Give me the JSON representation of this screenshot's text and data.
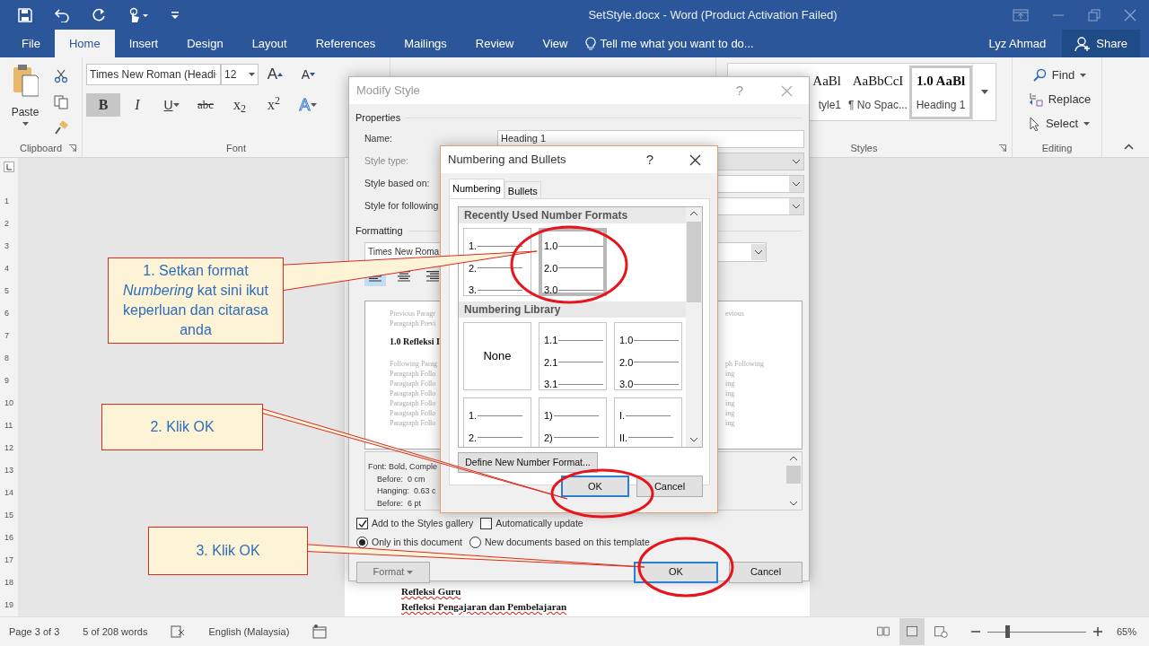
{
  "title_bar": {
    "title": "SetStyle.docx - Word (Product Activation Failed)"
  },
  "ribbon_tabs": [
    {
      "label": "File",
      "selected": false
    },
    {
      "label": "Home",
      "selected": true
    },
    {
      "label": "Insert",
      "selected": false
    },
    {
      "label": "Design",
      "selected": false
    },
    {
      "label": "Layout",
      "selected": false
    },
    {
      "label": "References",
      "selected": false
    },
    {
      "label": "Mailings",
      "selected": false
    },
    {
      "label": "Review",
      "selected": false
    },
    {
      "label": "View",
      "selected": false
    }
  ],
  "tell_me": {
    "placeholder": "Tell me what you want to do..."
  },
  "user": "Lyz Ahmad",
  "share_button": "Share",
  "clipboard": {
    "paste": "Paste",
    "group_label": "Clipboard"
  },
  "font": {
    "font_name": "Times New Roman (Headi",
    "font_size": "12",
    "size_buttons": [
      {
        "label": "A",
        "kind": "grow"
      },
      {
        "label": "A",
        "kind": "shrink"
      }
    ],
    "format_buttons": [
      {
        "label": "B",
        "kind": "bold",
        "on": true
      },
      {
        "label": "I",
        "kind": "italic",
        "on": false
      },
      {
        "label": "U",
        "kind": "underline",
        "on": false
      },
      {
        "label": "abc",
        "kind": "strike",
        "on": false
      },
      {
        "label": "x$_{2}$",
        "kind": "script",
        "on": false
      },
      {
        "label": "x$^{2}$",
        "kind": "script",
        "on": false
      },
      {
        "label": "A",
        "kind": "effect",
        "on": false
      }
    ],
    "group_label": "Font"
  },
  "styles": {
    "gallery": [
      {
        "preview": "AaBl",
        "name": "tyle1",
        "selected": false
      },
      {
        "preview": "AaBbCcI",
        "name": "¶ No Spac...",
        "selected": false
      },
      {
        "preview": "1.0  AaBl",
        "name": "Heading 1",
        "selected": true
      }
    ],
    "group_label": "Styles"
  },
  "editing": {
    "items": [
      {
        "label": "Find",
        "kind": "find"
      },
      {
        "label": "Replace",
        "kind": "replace"
      },
      {
        "label": "Select",
        "kind": "select"
      }
    ],
    "group_label": "Editing"
  },
  "ruler": [
    "1",
    "2",
    "3",
    "4",
    "5",
    "6",
    "7",
    "8",
    "9",
    "10",
    "11",
    "12",
    "13",
    "14",
    "15",
    "16",
    "17",
    "18",
    "19"
  ],
  "document": {
    "lines": [
      "Refleksi Guru",
      "Refleksi Pengajaran dan Pembelajaran"
    ]
  },
  "modify_style": {
    "title": "Modify Style",
    "help": "?",
    "properties_label": "Properties",
    "fields": [
      {
        "label": "Name:",
        "value": "Heading 1",
        "kind": "text",
        "disabled": false
      },
      {
        "label": "Style type:",
        "kind": "select",
        "disabled": true
      },
      {
        "label": "Style based on:",
        "kind": "select",
        "disabled": false
      },
      {
        "label": "Style for following",
        "kind": "select",
        "disabled": false
      }
    ],
    "formatting_label": "Formatting",
    "font_value": "Times New Roma",
    "alignment": [
      {
        "kind": "left",
        "selected": true
      },
      {
        "kind": "center",
        "selected": false
      },
      {
        "kind": "right",
        "selected": false
      }
    ],
    "preview": [
      {
        "left": "Previous Paragr",
        "right": "evious",
        "kind": "faint"
      },
      {
        "left": "Paragraph Previ",
        "kind": "faint"
      },
      {
        "left": "1.0 Refleksi I",
        "kind": "heading"
      },
      {
        "left": "Following Parag",
        "right": "ph Following",
        "kind": "faint"
      },
      {
        "left": "Paragraph Follo",
        "right": "ing",
        "kind": "faint"
      },
      {
        "left": "Paragraph Follo",
        "right": "ing",
        "kind": "faint"
      },
      {
        "left": "Paragraph Follo",
        "right": "ing",
        "kind": "faint"
      },
      {
        "left": "Paragraph Follo",
        "right": "ing",
        "kind": "faint"
      },
      {
        "left": "Paragraph Follo",
        "right": "ing",
        "kind": "faint"
      },
      {
        "left": "Paragraph Follo",
        "right": "ing",
        "kind": "faint"
      }
    ],
    "description": [
      "Font: Bold, Comple",
      "Before:  0 cm",
      "Hanging:  0.63 c",
      "Before:  6 pt"
    ],
    "options": [
      {
        "label": "Add to the Styles gallery",
        "checked": true
      },
      {
        "label": "Automatically update",
        "checked": false
      }
    ],
    "scope": [
      {
        "label": "Only in this document",
        "selected": true
      },
      {
        "label": "New documents based on this template",
        "selected": false
      }
    ],
    "buttons": [
      "Format",
      "OK",
      "Cancel"
    ]
  },
  "numbering_dialog": {
    "title": "Numbering and Bullets",
    "help": "?",
    "tabs": [
      {
        "label": "Numbering",
        "selected": true
      },
      {
        "label": "Bullets",
        "selected": false
      }
    ],
    "sections": [
      {
        "heading": "Recently Used Number Formats",
        "tiles": [
          {
            "kind": "list",
            "lines": [
              "1.",
              "2.",
              "3."
            ],
            "selected": false
          },
          {
            "kind": "list",
            "lines": [
              "1.0",
              "2.0",
              "3.0"
            ],
            "selected": true
          }
        ]
      },
      {
        "heading": "Numbering Library",
        "tiles": [
          {
            "kind": "none",
            "label": "None",
            "selected": false
          },
          {
            "kind": "list",
            "lines": [
              "1.1",
              "2.1",
              "3.1"
            ],
            "selected": false
          },
          {
            "kind": "list",
            "lines": [
              "1.0",
              "2.0",
              "3.0"
            ],
            "selected": false
          },
          {
            "kind": "list",
            "lines": [
              "1.",
              "2."
            ],
            "selected": false
          },
          {
            "kind": "list",
            "lines": [
              "1)",
              "2)"
            ],
            "selected": false
          },
          {
            "kind": "list",
            "lines": [
              "I.",
              "II."
            ],
            "selected": false
          }
        ]
      }
    ],
    "define_button": "Define New Number Format...",
    "buttons": [
      "OK",
      "Cancel"
    ]
  },
  "callouts": [
    {
      "text": "1. Setkan format *Numbering* kat sini ikut keperluan dan citarasa anda"
    },
    {
      "text": "2. Klik OK"
    },
    {
      "text": "3. Klik OK"
    }
  ],
  "status_bar": {
    "page": "Page 3 of 3",
    "words": "5 of 208 words",
    "language": "English (Malaysia)",
    "views": [
      {
        "kind": "read",
        "selected": false
      },
      {
        "kind": "print",
        "selected": true
      },
      {
        "kind": "web",
        "selected": false
      }
    ],
    "zoom": {
      "level": 0.2
    },
    "zoom_label": "65%"
  }
}
